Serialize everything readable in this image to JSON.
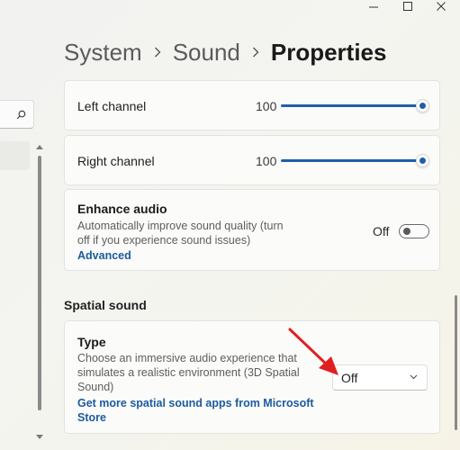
{
  "breadcrumb": {
    "level1": "System",
    "level2": "Sound",
    "level3": "Properties"
  },
  "channels": [
    {
      "label": "Left channel",
      "value": "100",
      "level": 1.0
    },
    {
      "label": "Right channel",
      "value": "100",
      "level": 1.0
    }
  ],
  "enhance_audio": {
    "title": "Enhance audio",
    "description_line1": "Automatically improve sound quality (turn",
    "description_line2": "off if you experience sound issues)",
    "link": "Advanced",
    "toggle_label": "Off",
    "toggle_on": false
  },
  "spatial_sound": {
    "section_title": "Spatial sound",
    "title": "Type",
    "description_line1": "Choose an immersive audio experience that",
    "description_line2": "simulates a realistic environment (3D Spatial",
    "description_line3": "Sound)",
    "link_line1": "Get more spatial sound apps from Microsoft",
    "link_line2": "Store",
    "dropdown_value": "Off"
  },
  "colors": {
    "accent": "#1f5fa8",
    "link": "#1c5a9e",
    "arrow": "#e02020"
  },
  "icons": {
    "minimize": "minimize-icon",
    "maximize": "maximize-icon",
    "close": "close-icon",
    "search": "search-icon",
    "breadcrumb_separator": "chevron-right-icon",
    "dropdown": "chevron-down-icon"
  }
}
